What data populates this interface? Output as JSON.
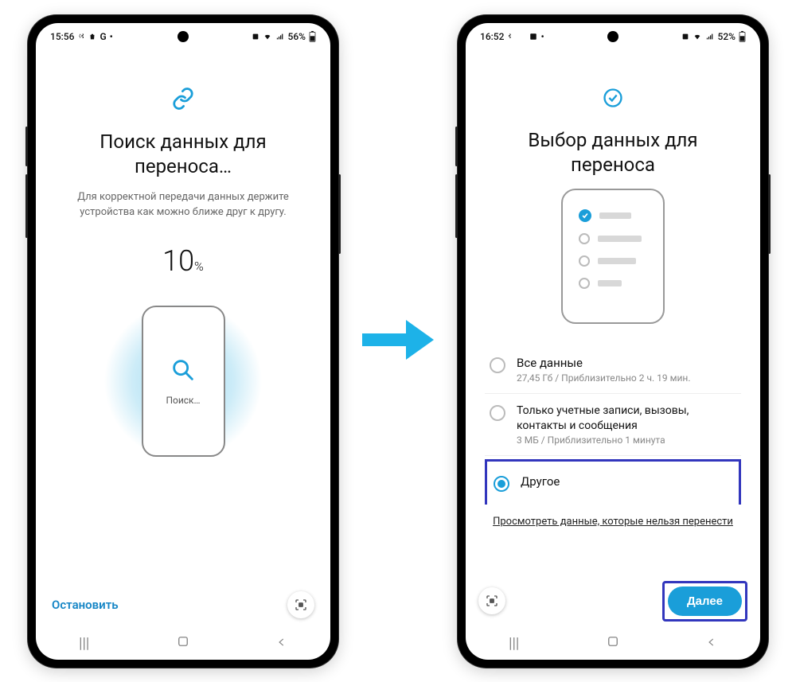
{
  "left": {
    "status": {
      "time": "15:56",
      "battery": "56%"
    },
    "title": "Поиск данных для переноса…",
    "subtitle": "Для корректной передачи данных держите устройства как можно ближе друг к другу.",
    "percent_value": "10",
    "percent_unit": "%",
    "search_label": "Поиск…",
    "stop": "Остановить"
  },
  "right": {
    "status": {
      "time": "16:52",
      "battery": "52%"
    },
    "title": "Выбор данных для переноса",
    "options": {
      "all_title": "Все данные",
      "all_sub": "27,45 Гб / Приблизительно 2 ч. 19 мин.",
      "acc_title": "Только учетные записи, вызовы, контакты и сообщения",
      "acc_sub": "3 МБ / Приблизительно 1 минута",
      "other_title": "Другое"
    },
    "view_link": "Просмотреть данные, которые нельзя перенести",
    "next": "Далее"
  }
}
